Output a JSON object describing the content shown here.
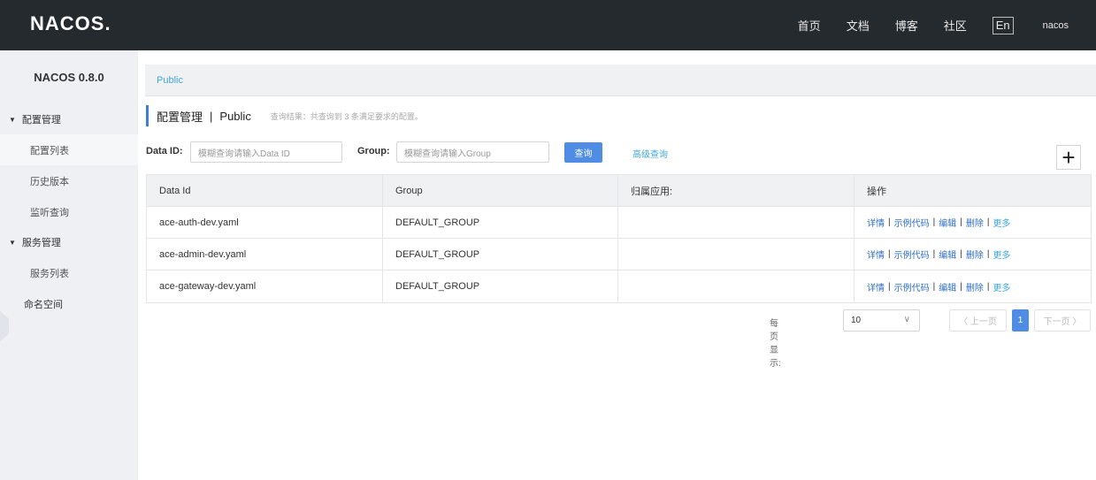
{
  "header": {
    "logo": "NACOS.",
    "nav": [
      "首页",
      "文档",
      "博客",
      "社区"
    ],
    "lang": "En",
    "user": "nacos"
  },
  "sidebar": {
    "title": "NACOS 0.8.0",
    "groups": [
      {
        "label": "配置管理",
        "items": [
          "配置列表",
          "历史版本",
          "监听查询"
        ]
      },
      {
        "label": "服务管理",
        "items": [
          "服务列表"
        ]
      }
    ],
    "namespace": "命名空间"
  },
  "breadcrumb": "Public",
  "page": {
    "title": "配置管理",
    "separator": "|",
    "namespace": "Public",
    "hint": "查询结果：共查询到 3 条满足要求的配置。"
  },
  "search": {
    "dataid_label": "Data ID:",
    "dataid_placeholder": "模糊查询请输入Data ID",
    "group_label": "Group:",
    "group_placeholder": "模糊查询请输入Group",
    "query_button": "查询",
    "advanced_link": "高级查询",
    "add_button": "+"
  },
  "table": {
    "headers": [
      "Data Id",
      "Group",
      "归属应用:",
      "操作"
    ],
    "rows": [
      {
        "data_id": "ace-auth-dev.yaml",
        "group": "DEFAULT_GROUP",
        "app": ""
      },
      {
        "data_id": "ace-admin-dev.yaml",
        "group": "DEFAULT_GROUP",
        "app": ""
      },
      {
        "data_id": "ace-gateway-dev.yaml",
        "group": "DEFAULT_GROUP",
        "app": ""
      }
    ],
    "actions": [
      "详情",
      "示例代码",
      "编辑",
      "删除",
      "更多"
    ],
    "action_separator": "|"
  },
  "pagination": {
    "per_page_label": "每页显示:",
    "per_page_value": "10",
    "prev": "〈 上一页",
    "current": "1",
    "next": "下一页 〉"
  }
}
